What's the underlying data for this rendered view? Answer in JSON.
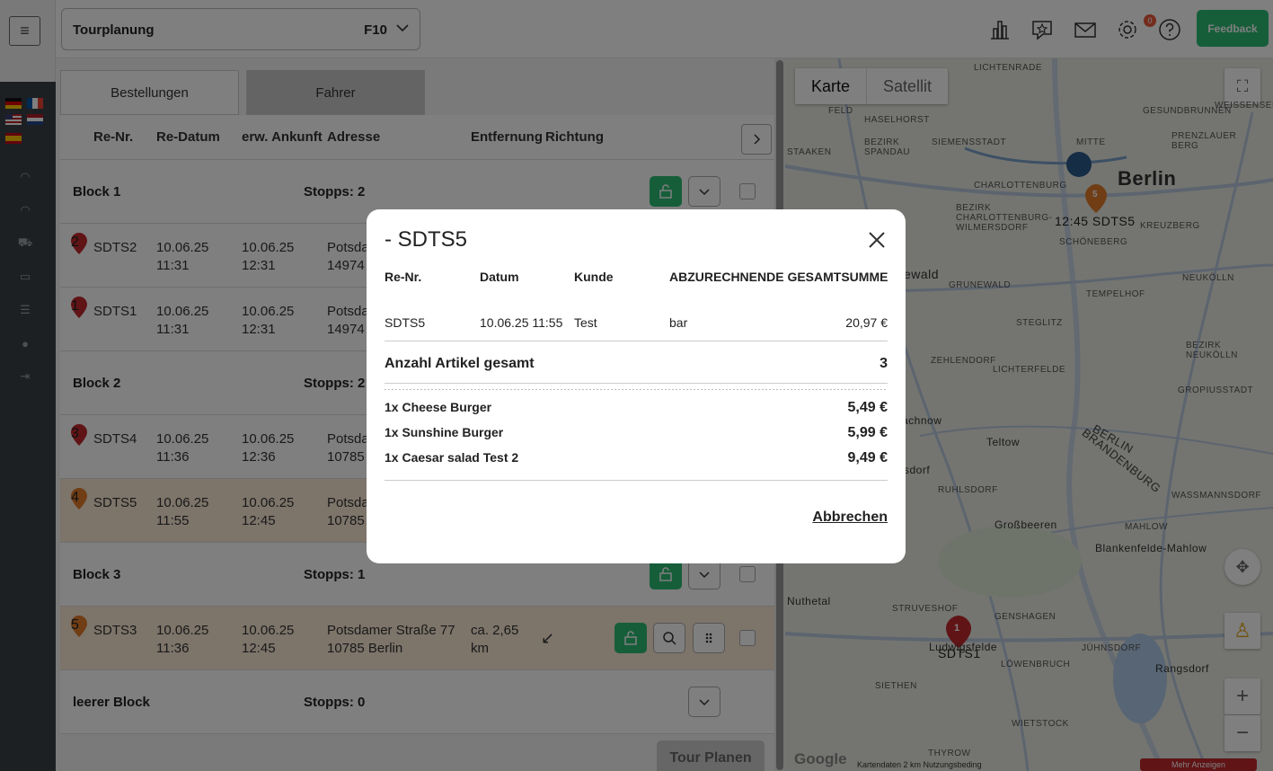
{
  "header": {
    "tour_label": "Tourplanung",
    "tour_value": "F10",
    "mail_badge": "0",
    "feedback_label": "Feedback"
  },
  "tabs": [
    {
      "label": "Bestellungen"
    },
    {
      "label": "Fahrer"
    }
  ],
  "columns": [
    "Re-Nr.",
    "Re-Datum",
    "erw. Ankunft",
    "Adresse",
    "Entfernung",
    "Richtung"
  ],
  "blocks": [
    {
      "name": "Block 1",
      "stops": "Stopps: 2"
    },
    {
      "name": "Block 2",
      "stops": "Stopps: 2"
    },
    {
      "name": "Block 3",
      "stops": "Stopps: 1"
    },
    {
      "name": "leerer Block",
      "stops": "Stopps: 0"
    }
  ],
  "rows": [
    {
      "pin": "2",
      "nr": "SDTS2",
      "date": "10.06.25\n11:31",
      "arrival": "10.06.25\n12:31",
      "address": "Potsda\n14974"
    },
    {
      "pin": "1",
      "nr": "SDTS1",
      "date": "10.06.25\n11:31",
      "arrival": "10.06.25\n12:31",
      "address": "Potsda\n14974"
    },
    {
      "pin": "3",
      "nr": "SDTS4",
      "date": "10.06.25\n11:36",
      "arrival": "10.06.25\n12:36",
      "address": "Potsda\n10785"
    },
    {
      "pin": "4",
      "nr": "SDTS5",
      "date": "10.06.25\n11:55",
      "arrival": "10.06.25\n12:45",
      "address": "Potsda\n10785"
    },
    {
      "pin": "5",
      "nr": "SDTS3",
      "date": "10.06.25\n11:36",
      "arrival": "10.06.25\n12:45",
      "address": "Potsdamer Straße 77\n10785 Berlin",
      "distance": "ca. 2,65\nkm",
      "direction": "↙"
    }
  ],
  "plan_button": "Tour Planen",
  "map": {
    "type_map": "Karte",
    "type_sat": "Satellit",
    "city": "Berlin",
    "marker_label_1": "12:45 SDTS5",
    "marker_label_2": "SDTS1",
    "marker_num": "1",
    "marker_num_orange": "5",
    "labels": [
      "HASELHORST",
      "SIEMENSSTADT",
      "MITTE",
      "GESUNDBRUNNEN",
      "WEISSENSEE",
      "PRENZLAUER BERG",
      "BEZIRK SPANDAU",
      "STAAKEN",
      "CHARLOTTENBURG",
      "SCHÖNEBERG",
      "BEZIRK CHARLOTTENBURG-WILMERSDORF",
      "KREUZBERG",
      "GRUNEWALD",
      "TEMPELHOF",
      "NEUKÖLLN",
      "STEGLITZ",
      "BEZIRK NEUKÖLLN",
      "ZEHLENDORF",
      "LICHTERFELDE",
      "GROPIUSSTADT",
      "Teltow",
      "BERLIN",
      "BRANDENBURG",
      "RUHLSDORF",
      "WASSMANNSDORF",
      "Großbeeren",
      "MAHLOW",
      "Blankenfelde-Mahlow",
      "STRUVESHOF",
      "GENSHAGEN",
      "JÜHNSDORF",
      "Ludwigsfelde",
      "LÖWENBRUCH",
      "Rangsdorf",
      "SIETHEN",
      "WIETSTOCK",
      "THYROW",
      "Nuthetal",
      "FELD",
      "LICHTENRADE",
      "achnow",
      "sdorf",
      "ewald"
    ],
    "footer": "Kartendaten   2 km   Nutzungsbeding",
    "more": "Mehr Anzeigen",
    "google": "Google"
  },
  "modal": {
    "title": "- SDTS5",
    "headers": [
      "Re-Nr.",
      "Datum",
      "Kunde",
      "ABZURECHNENDE GESAMTSUMME"
    ],
    "order": {
      "nr": "SDTS5",
      "date": "10.06.25 11:55",
      "customer": "Test",
      "payment": "bar",
      "total": "20,97 €"
    },
    "count_label": "Anzahl Artikel gesamt",
    "count_value": "3",
    "items": [
      {
        "name": "1x Cheese Burger",
        "price": "5,49 €"
      },
      {
        "name": "1x Sunshine Burger",
        "price": "5,99 €"
      },
      {
        "name": "1x Caesar salad Test 2",
        "price": "9,49 €"
      }
    ],
    "cancel_label": "Abbrechen"
  },
  "colors": {
    "accent": "#2dbc74",
    "highlight": "#fae8d5",
    "pin_red": "#c0282d",
    "pin_orange": "#e07b2a"
  }
}
